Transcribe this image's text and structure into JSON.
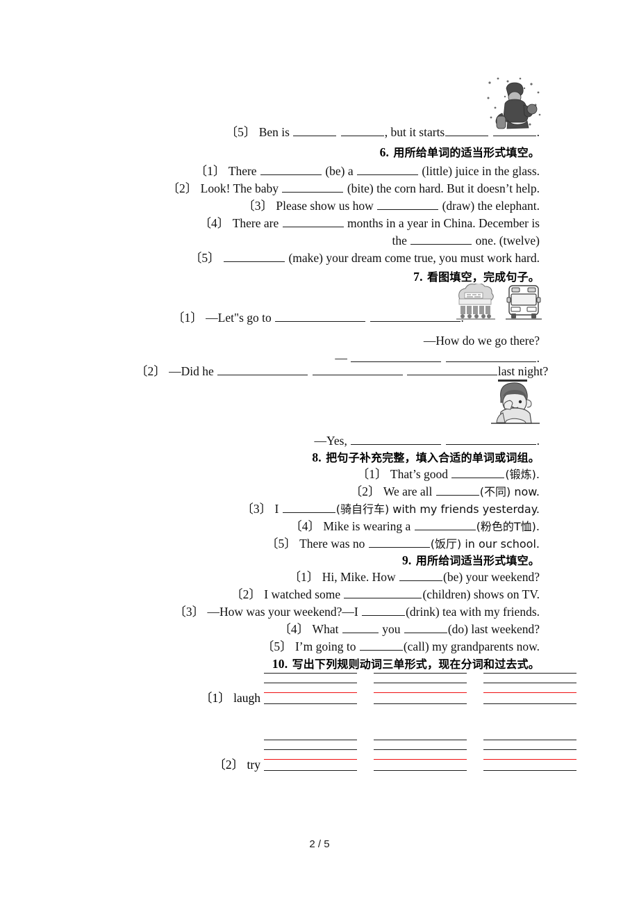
{
  "page": {
    "footer_label": "2 / 5",
    "accent_red": "#ef0f10",
    "ink": "#101010"
  },
  "exercise5": {
    "item5_marker": "〔5〕",
    "item5_pre": "Ben is",
    "item5_mid": ", but it starts",
    "item5_end": "."
  },
  "exercise6": {
    "heading_num": "6.",
    "heading_text": "用所给单词的适当形式填空。",
    "items": [
      {
        "marker": "〔1〕",
        "p1": "There",
        "p2": "(be) a",
        "p3": "(little) juice in the glass."
      },
      {
        "marker": "〔2〕",
        "p1": "Look! The baby",
        "p2": "(bite) the corn hard. But it doesn’t help."
      },
      {
        "marker": "〔3〕",
        "p1": "Please show us how",
        "p2": "(draw) the elephant."
      },
      {
        "marker": "〔4〕",
        "p1": "There are",
        "p2": "months in a year in China. December is",
        "p3": "the",
        "p4": "one. (twelve)"
      },
      {
        "marker": "〔5〕",
        "p1": "",
        "p2": "(make) your dream come true, you must work hard."
      }
    ]
  },
  "exercise7": {
    "heading_num": "7.",
    "heading_text": "看图填空，完成句子。",
    "item1_marker": "〔1〕",
    "item1_text": "—Let\"s go to",
    "item1_end": ".",
    "item1_q": "—How do we go there?",
    "item1_answer_dash": "—",
    "item1_answer_end": ".",
    "item2_marker": "〔2〕",
    "item2_text": "—Did he",
    "item2_end": "last night?",
    "item2_answer": "—Yes,",
    "item2_answer_end": ".",
    "art_cinema": "cinema-clipart",
    "art_bus": "bus-clipart",
    "art_boy": "boy-thinking-clipart",
    "art_snow": "person-in-snow-clipart"
  },
  "exercise8": {
    "heading_num": "8.",
    "heading_text": "把句子补充完整，填入合适的单词或词组。",
    "items": [
      {
        "marker": "〔1〕",
        "p1": "That’s good",
        "p2": "(锻炼)."
      },
      {
        "marker": "〔2〕",
        "p1": "We are all",
        "p2": "(不同) now."
      },
      {
        "marker": "〔3〕",
        "p1": "I",
        "p2": "(骑自行车) with my friends yesterday."
      },
      {
        "marker": "〔4〕",
        "p1": "Mike is wearing a",
        "p2": "(粉色的T恤)."
      },
      {
        "marker": "〔5〕",
        "p1": "There was no",
        "p2": "(饭厅) in our school."
      }
    ]
  },
  "exercise9": {
    "heading_num": "9.",
    "heading_text": "用所给词适当形式填空。",
    "items": [
      {
        "marker": "〔1〕",
        "p1": "Hi, Mike. How",
        "p2": "(be) your weekend?"
      },
      {
        "marker": "〔2〕",
        "p1": "I watched some",
        "p2": "(children) shows on TV."
      },
      {
        "marker": "〔3〕",
        "p1": "—How was your weekend?—I",
        "p2": "(drink) tea with my friends."
      },
      {
        "marker": "〔4〕",
        "p1": "What",
        "p2": "you",
        "p3": "(do) last weekend?"
      },
      {
        "marker": "〔5〕",
        "p1": "I’m going to",
        "p2": "(call) my grandparents now."
      }
    ]
  },
  "exercise10": {
    "heading_num": "10.",
    "heading_text": "写出下列规则动词三单形式，现在分词和过去式。",
    "rows": [
      {
        "marker": "〔1〕",
        "word": "laugh",
        "columns": 3
      },
      {
        "marker": "〔2〕",
        "word": "try",
        "columns": 3
      }
    ]
  }
}
